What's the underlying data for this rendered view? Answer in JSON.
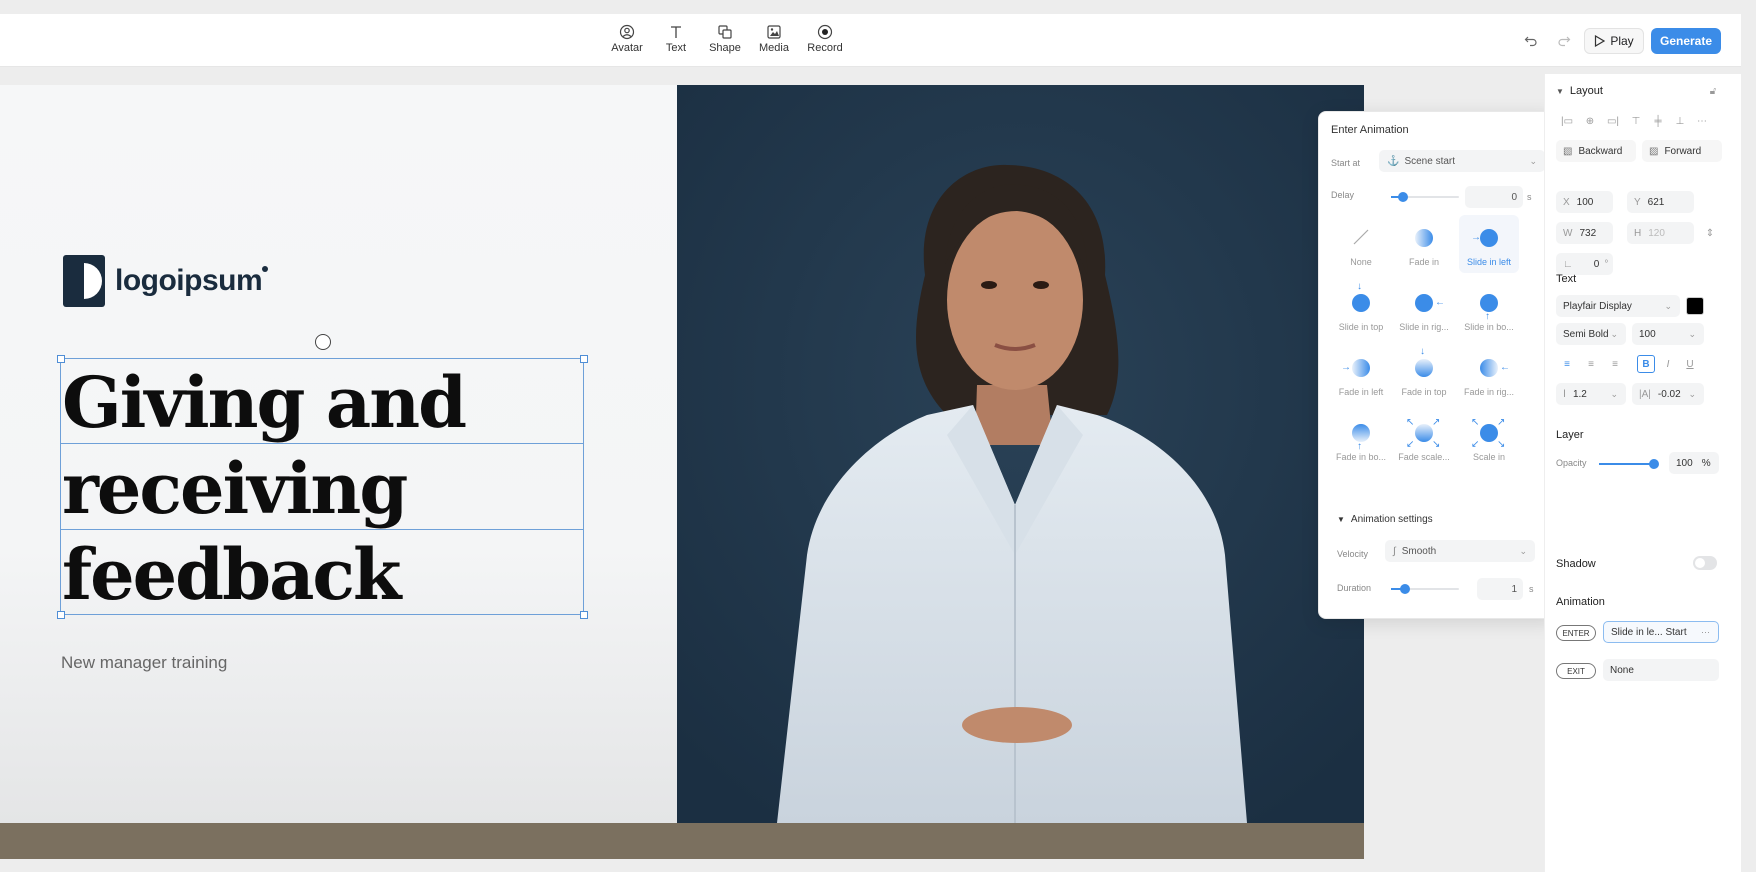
{
  "toolbar": {
    "tools": [
      {
        "label": "Avatar",
        "icon": "avatar-icon"
      },
      {
        "label": "Text",
        "icon": "text-icon"
      },
      {
        "label": "Shape",
        "icon": "shape-icon"
      },
      {
        "label": "Media",
        "icon": "media-icon"
      },
      {
        "label": "Record",
        "icon": "record-icon"
      }
    ],
    "play_label": "Play",
    "generate_label": "Generate",
    "accent": "#3b8ce8"
  },
  "canvas": {
    "logo_text": "logoipsum",
    "headline": [
      "Giving and",
      "receiving",
      "feedback"
    ],
    "subtitle": "New manager training",
    "background_color": "#1f3447"
  },
  "enter_animation": {
    "title": "Enter Animation",
    "start_at_label": "Start at",
    "start_at_value": "Scene start",
    "delay_label": "Delay",
    "delay_value": "0",
    "delay_unit": "s",
    "options": [
      {
        "label": "None",
        "selected": false
      },
      {
        "label": "Fade in",
        "selected": false
      },
      {
        "label": "Slide in left",
        "selected": true
      },
      {
        "label": "Slide in top",
        "selected": false
      },
      {
        "label": "Slide in rig...",
        "selected": false
      },
      {
        "label": "Slide in bo...",
        "selected": false
      },
      {
        "label": "Fade in left",
        "selected": false
      },
      {
        "label": "Fade in top",
        "selected": false
      },
      {
        "label": "Fade in rig...",
        "selected": false
      },
      {
        "label": "Fade in bo...",
        "selected": false
      },
      {
        "label": "Fade scale...",
        "selected": false
      },
      {
        "label": "Scale in",
        "selected": false
      }
    ],
    "settings_label": "Animation settings",
    "velocity_label": "Velocity",
    "velocity_value": "Smooth",
    "duration_label": "Duration",
    "duration_value": "1",
    "duration_unit": "s"
  },
  "panel": {
    "layout_title": "Layout",
    "backward_label": "Backward",
    "forward_label": "Forward",
    "x_key": "X",
    "x_value": "100",
    "y_key": "Y",
    "y_value": "621",
    "w_key": "W",
    "w_value": "732",
    "h_key": "H",
    "h_value": "120",
    "rotation_value": "0",
    "rotation_unit": "°",
    "text_title": "Text",
    "font_family": "Playfair Display",
    "font_color": "#000000",
    "font_weight": "Semi Bold",
    "font_size": "100",
    "line_height": "1.2",
    "letter_spacing": "-0.02",
    "layer_title": "Layer",
    "opacity_label": "Opacity",
    "opacity_value": "100",
    "opacity_unit": "%",
    "shadow_label": "Shadow",
    "animation_title": "Animation",
    "enter_tag": "ENTER",
    "enter_value": "Slide in le... Start",
    "exit_tag": "EXIT",
    "exit_value": "None"
  }
}
